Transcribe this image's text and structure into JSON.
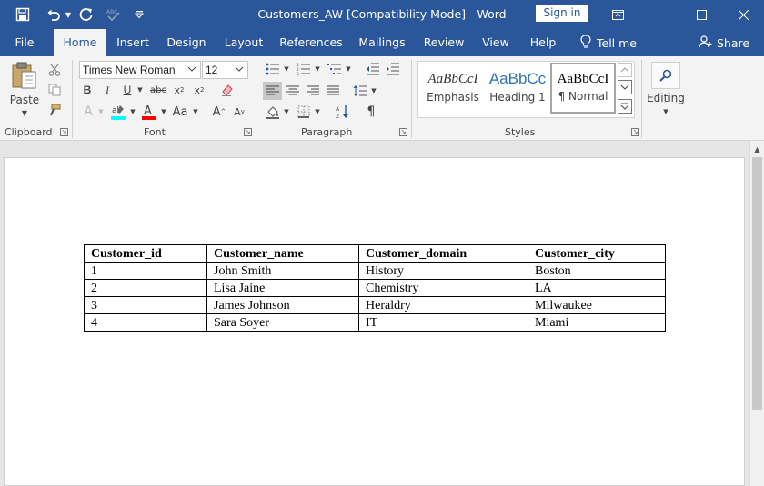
{
  "window": {
    "title": "Customers_AW [Compatibility Mode]  -  Word",
    "sign_in": "Sign in"
  },
  "tabs": [
    {
      "label": "File"
    },
    {
      "label": "Home"
    },
    {
      "label": "Insert"
    },
    {
      "label": "Design"
    },
    {
      "label": "Layout"
    },
    {
      "label": "References"
    },
    {
      "label": "Mailings"
    },
    {
      "label": "Review"
    },
    {
      "label": "View"
    },
    {
      "label": "Help"
    }
  ],
  "tell_me": "Tell me",
  "share": "Share",
  "ribbon": {
    "clipboard": {
      "label": "Clipboard",
      "paste": "Paste"
    },
    "font": {
      "label": "Font",
      "name": "Times New Roman",
      "size": "12"
    },
    "paragraph": {
      "label": "Paragraph"
    },
    "styles": {
      "label": "Styles",
      "items": [
        {
          "sample": "AaBbCcI",
          "name": "Emphasis"
        },
        {
          "sample": "AaBbCc",
          "name": "Heading 1"
        },
        {
          "sample": "AaBbCcI",
          "name": "¶ Normal"
        }
      ]
    },
    "editing": {
      "label": "Editing"
    }
  },
  "colors": {
    "accent": "#2b579a",
    "highlight": "#00ffff",
    "font_color": "#ff0000"
  },
  "table": {
    "headers": [
      "Customer_id",
      "Customer_name",
      "Customer_domain",
      "Customer_city"
    ],
    "rows": [
      [
        "1",
        "John Smith",
        "History",
        "Boston"
      ],
      [
        "2",
        "Lisa Jaine",
        "Chemistry",
        "LA"
      ],
      [
        "3",
        "James Johnson",
        "Heraldry",
        "Milwaukee"
      ],
      [
        "4",
        "Sara Soyer",
        "IT",
        "Miami"
      ]
    ]
  }
}
